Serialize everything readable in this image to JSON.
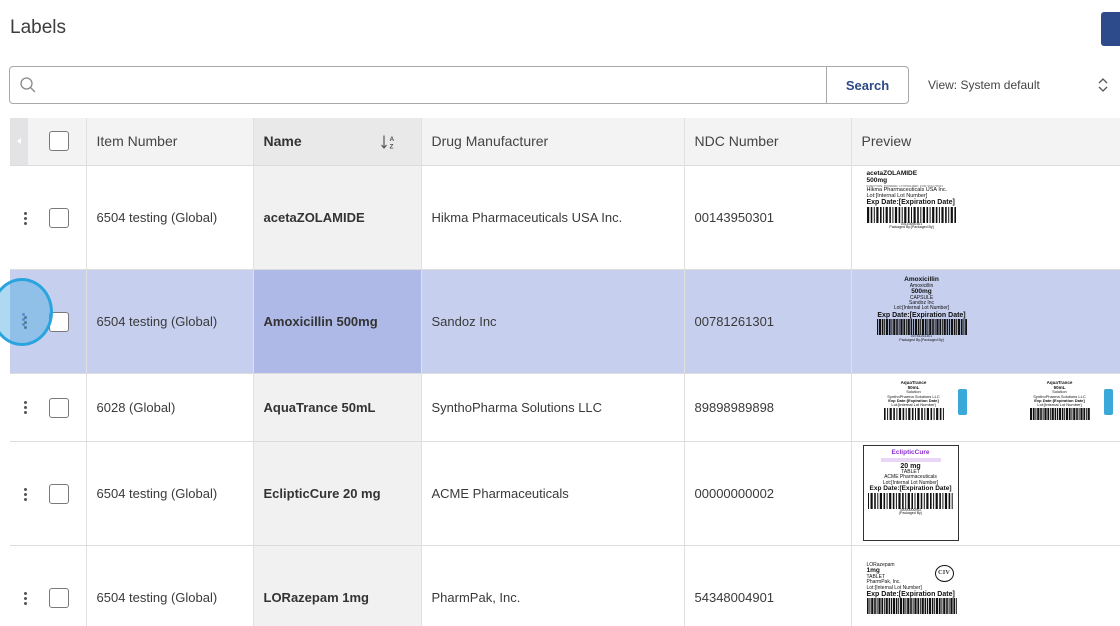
{
  "page": {
    "title": "Labels"
  },
  "search": {
    "placeholder": "",
    "value": "",
    "button_label": "Search"
  },
  "view": {
    "label": "View: System default"
  },
  "table": {
    "columns": {
      "item_number": "Item Number",
      "name": "Name",
      "manufacturer": "Drug Manufacturer",
      "ndc": "NDC Number",
      "preview": "Preview"
    },
    "rows": [
      {
        "item": "6504 testing (Global)",
        "name": "acetaZOLAMIDE",
        "manufacturer": "Hikma Pharmaceuticals USA Inc.",
        "ndc": "00143950301",
        "label": {
          "l1": "acetaZOLAMIDE",
          "l2": "500mg",
          "l3": "INJECTION, POWDER, LYOPHILIZED, FOR SOLUTION",
          "l4": "Hikma Pharmaceuticals USA Inc.",
          "l5": "Lot:[Internal Lot Number]",
          "exp": "Exp Date:[Expiration Date]",
          "code": "00143950301",
          "pkg": "Packaged By:[Packaged By]"
        }
      },
      {
        "item": "6504 testing (Global)",
        "name": "Amoxicillin 500mg",
        "manufacturer": "Sandoz Inc",
        "ndc": "00781261301",
        "label": {
          "l1": "Amoxicillin",
          "l2": "Amoxicillin",
          "l3": "500mg",
          "l4": "CAPSULE",
          "l5": "Sandoz Inc",
          "l6": "Lot:[Internal Lot Number]",
          "exp": "Exp Date:[Expiration Date]",
          "code": "00781261301",
          "pkg": "Packaged By:[Packaged By]"
        }
      },
      {
        "item": "6028 (Global)",
        "name": "AquaTrance 50mL",
        "manufacturer": "SynthoPharma Solutions LLC",
        "ndc": "89898989898",
        "label": {
          "l1": "AquaTrance",
          "l2": "50mL",
          "l3": "Solution",
          "l4": "SynthoPharma Solutions LLC",
          "exp": "Exp Date:[Expiration Date]",
          "l5": "Lot:[Internal Lot Number]",
          "code": "89898989898"
        }
      },
      {
        "item": "6504 testing (Global)",
        "name": "EclipticCure 20 mg",
        "manufacturer": "ACME Pharmaceuticals",
        "ndc": "00000000002",
        "label": {
          "l1": "EclipticCure",
          "l2": "20 mg",
          "l3": "TABLET",
          "l4": "ACME Pharmaceuticals",
          "l5": "Lot:[Internal Lot Number]",
          "exp": "Exp Date:[Expiration Date]",
          "code": "00000000002",
          "pkg": "[Packaged By]"
        }
      },
      {
        "item": "6504 testing (Global)",
        "name": "LORazepam 1mg",
        "manufacturer": "PharmPak, Inc.",
        "ndc": "54348004901",
        "label": {
          "l1": "LORazepam",
          "l2": "1mg",
          "l3": "TABLET",
          "l4": "PharmPak, Inc.",
          "l5": "Lot:[Internal Lot Number]",
          "exp": "Exp Date:[Expiration Date]",
          "badge": "CIV"
        }
      }
    ]
  },
  "colors": {
    "accent": "#2c4a86",
    "selected_row": "#c6d0ee",
    "selected_name": "#aeb9e7",
    "focus_ring": "#2aa4de"
  },
  "icons": [
    "search-icon",
    "chevron-updown-icon",
    "sort-alpha-icon",
    "kebab-menu-icon",
    "collapse-arrow-icon"
  ]
}
